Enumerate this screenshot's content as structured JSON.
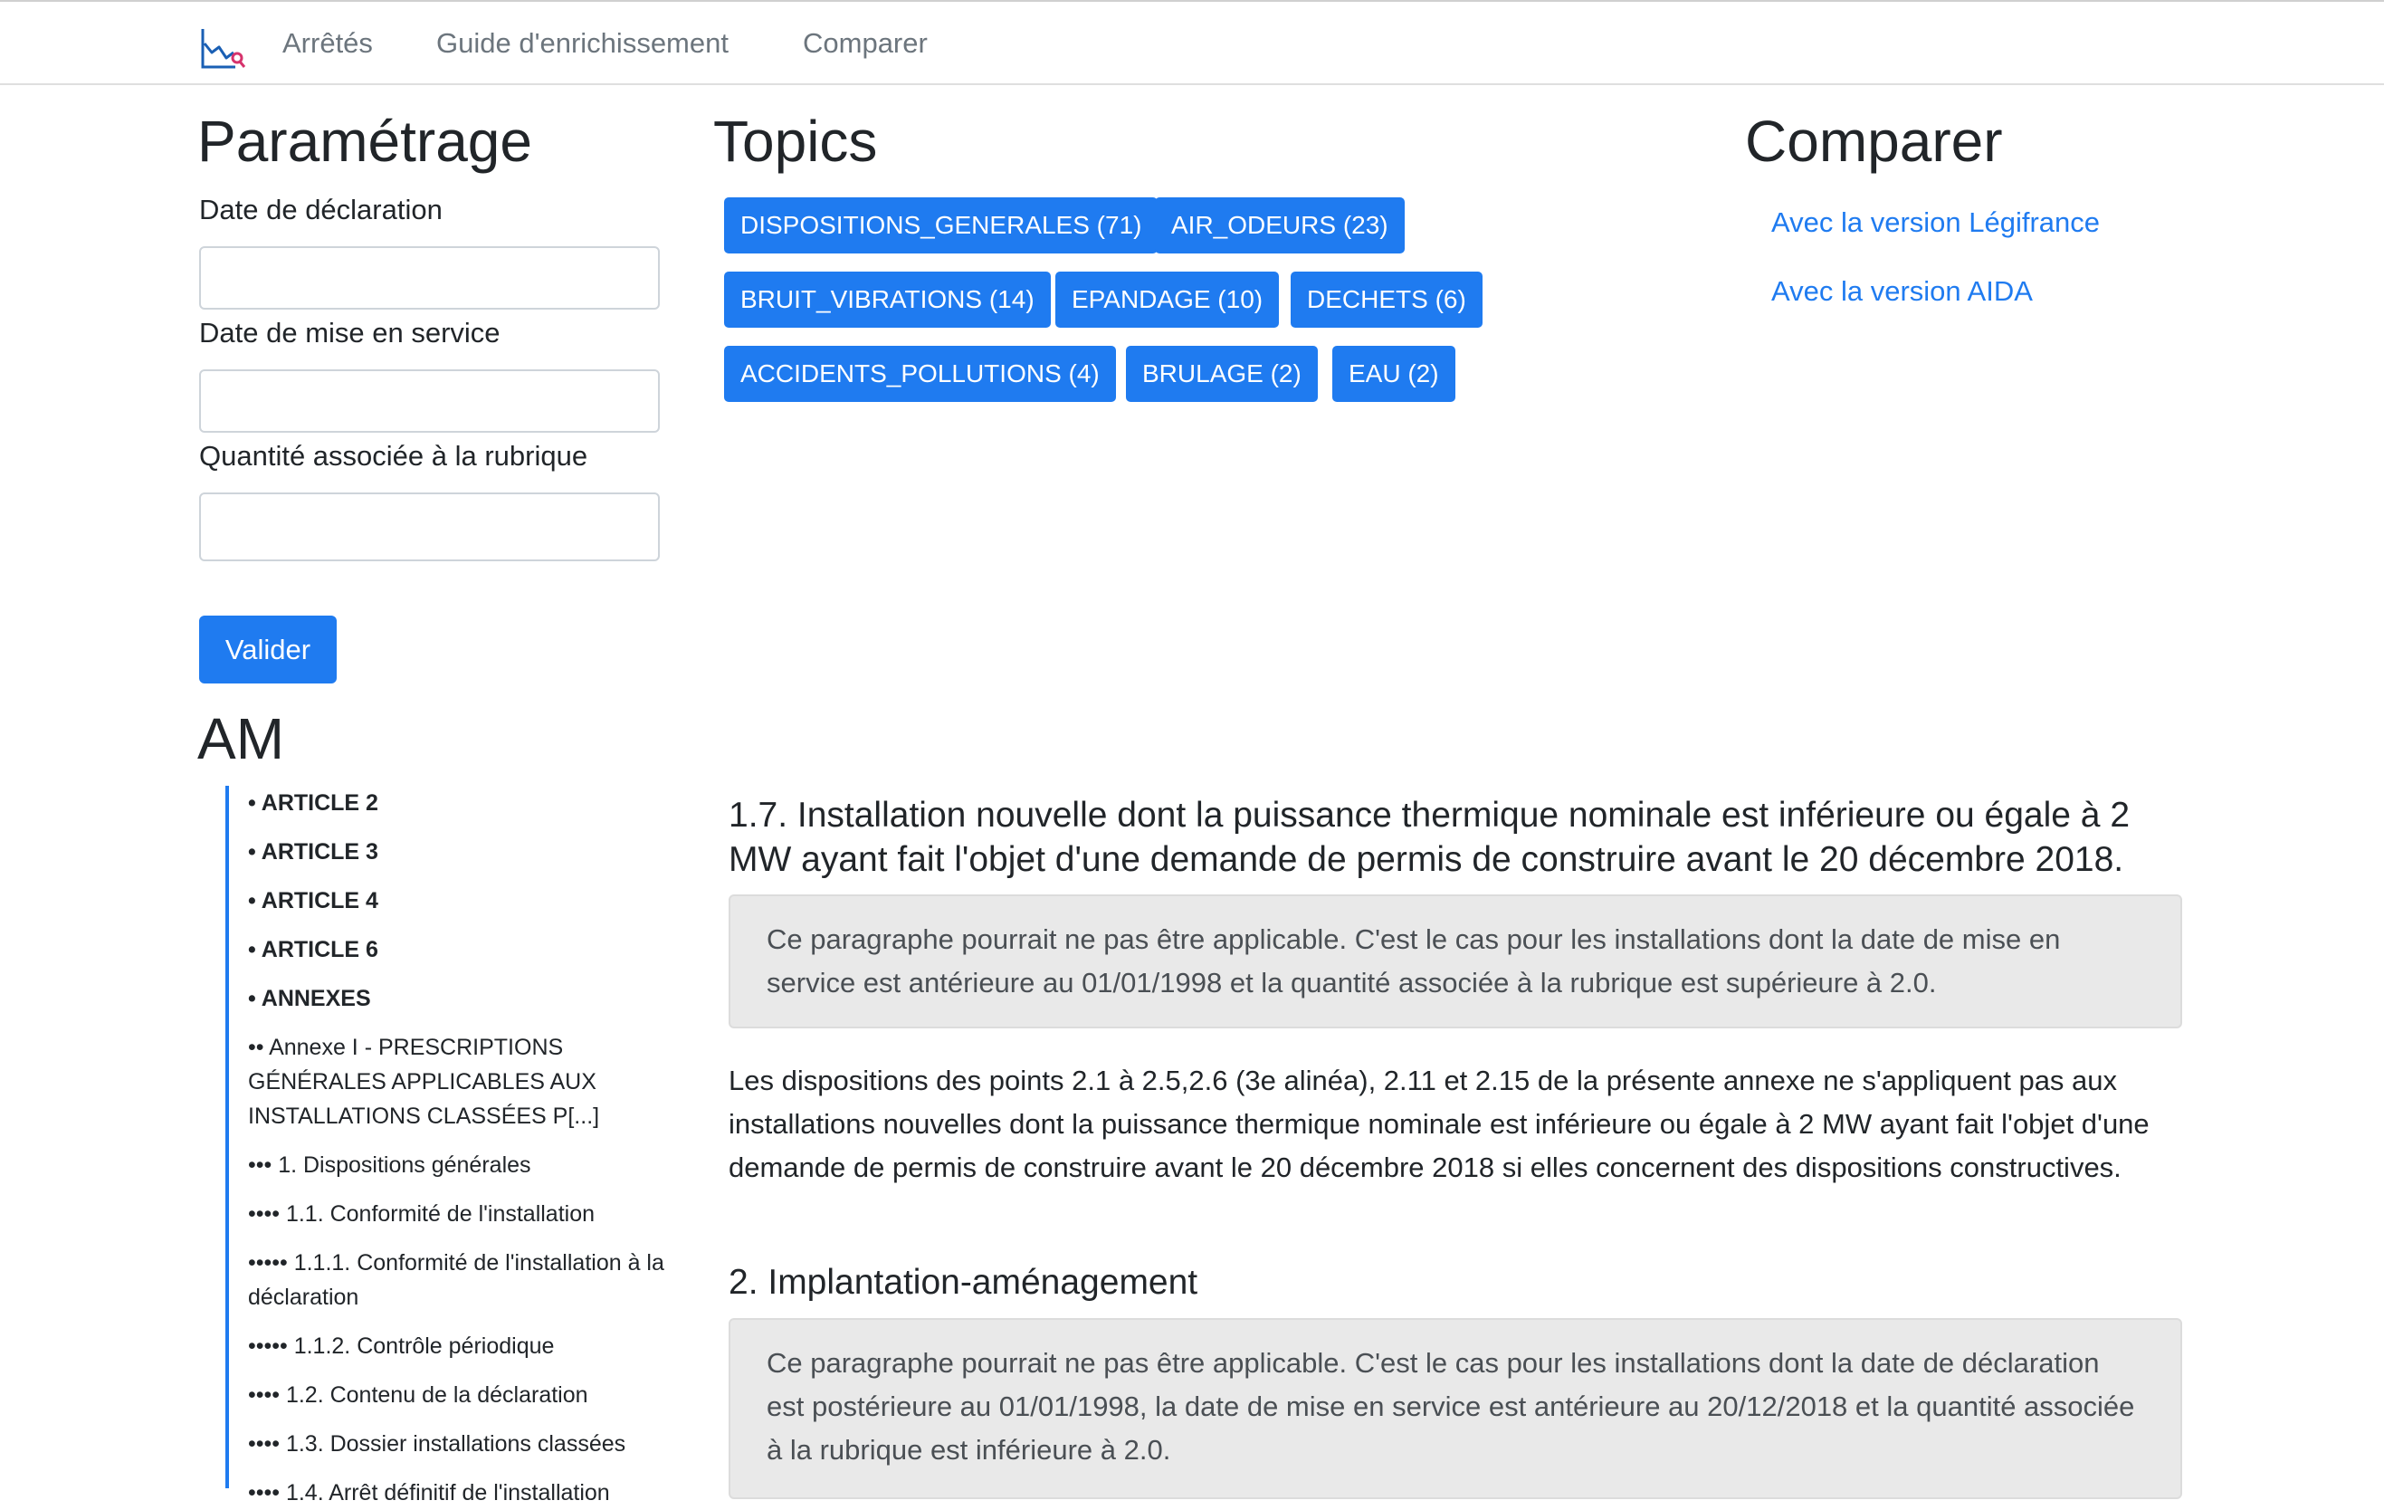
{
  "nav": {
    "logo_icon": "chart-magnifier-icon",
    "links": [
      "Arrêtés",
      "Guide d'enrichissement",
      "Comparer"
    ]
  },
  "params": {
    "title": "Paramétrage",
    "date_declaration_label": "Date de déclaration",
    "date_declaration_value": "",
    "date_service_label": "Date de mise en service",
    "date_service_value": "",
    "quantite_label": "Quantité associée à la rubrique",
    "quantite_value": "",
    "submit_label": "Valider"
  },
  "topics": {
    "title": "Topics",
    "items": [
      "DISPOSITIONS_GENERALES (71)",
      "AIR_ODEURS (23)",
      "BRUIT_VIBRATIONS (14)",
      "EPANDAGE (10)",
      "DECHETS (6)",
      "ACCIDENTS_POLLUTIONS (4)",
      "BRULAGE (2)",
      "EAU (2)"
    ]
  },
  "compare": {
    "title": "Comparer",
    "links": [
      "Avec la version Légifrance",
      "Avec la version AIDA"
    ]
  },
  "am": {
    "title": "AM",
    "accent_color": "#1f7bf0",
    "toc": [
      "• ARTICLE 2",
      "• ARTICLE 3",
      "• ARTICLE 4",
      "• ARTICLE 6",
      "• ANNEXES",
      "•• Annexe I - PRESCRIPTIONS GÉNÉRALES APPLICABLES AUX INSTALLATIONS CLASSÉES P[...]",
      "••• 1. Dispositions générales",
      "•••• 1.1. Conformité de l'installation",
      "••••• 1.1.1. Conformité de l'installation à la déclaration",
      "••••• 1.1.2. Contrôle périodique",
      "•••• 1.2. Contenu de la déclaration",
      "•••• 1.3. Dossier installations classées",
      "•••• 1.4. Arrêt définitif de l'installation"
    ]
  },
  "content": {
    "section1_title": "1.7. Installation nouvelle dont la puissance thermique nominale est inférieure ou égale à 2 MW ayant fait l'objet d'une demande de permis de construire avant le 20 décembre 2018.",
    "section1_warning": "Ce paragraphe pourrait ne pas être applicable. C'est le cas pour les installations dont la date de mise en service est antérieure au 01/01/1998 et la quantité associée à la rubrique est supérieure à 2.0.",
    "section1_text": "Les dispositions des points 2.1 à 2.5,2.6 (3e alinéa), 2.11 et 2.15 de la présente annexe ne s'appliquent pas aux installations nouvelles dont la puissance thermique nominale est inférieure ou égale à 2 MW ayant fait l'objet d'une demande de permis de construire avant le 20 décembre 2018 si elles concernent des dispositions constructives.",
    "section2_title": "2. Implantation-aménagement",
    "section2_warning": "Ce paragraphe pourrait ne pas être applicable. C'est le cas pour les installations dont la date de déclaration est postérieure au 01/01/1998, la date de mise en service est antérieure au 20/12/2018 et la quantité associée à la rubrique est inférieure à 2.0."
  }
}
